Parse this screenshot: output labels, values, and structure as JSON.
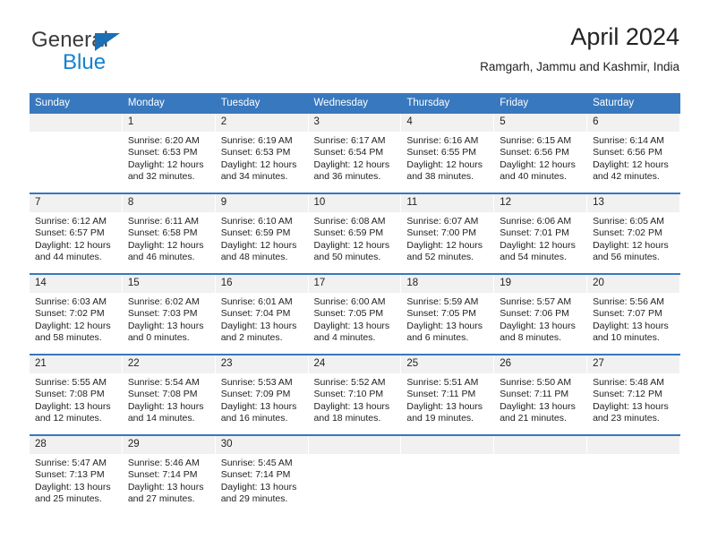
{
  "brand": {
    "name_top": "General",
    "name_bottom": "Blue",
    "triangle_color": "#1b6fb5",
    "blue_color": "#1581cf"
  },
  "header": {
    "title": "April 2024",
    "subtitle": "Ramgarh, Jammu and Kashmir, India"
  },
  "colors": {
    "header_row": "#3878be",
    "daynum_band": "#f1f1f1",
    "row_rule": "#3878be",
    "text": "#222222"
  },
  "weekday_headers": [
    "Sunday",
    "Monday",
    "Tuesday",
    "Wednesday",
    "Thursday",
    "Friday",
    "Saturday"
  ],
  "weeks": [
    [
      {
        "day": "",
        "sunrise": "",
        "sunset": "",
        "daylight": ""
      },
      {
        "day": "1",
        "sunrise": "Sunrise: 6:20 AM",
        "sunset": "Sunset: 6:53 PM",
        "daylight": "Daylight: 12 hours and 32 minutes."
      },
      {
        "day": "2",
        "sunrise": "Sunrise: 6:19 AM",
        "sunset": "Sunset: 6:53 PM",
        "daylight": "Daylight: 12 hours and 34 minutes."
      },
      {
        "day": "3",
        "sunrise": "Sunrise: 6:17 AM",
        "sunset": "Sunset: 6:54 PM",
        "daylight": "Daylight: 12 hours and 36 minutes."
      },
      {
        "day": "4",
        "sunrise": "Sunrise: 6:16 AM",
        "sunset": "Sunset: 6:55 PM",
        "daylight": "Daylight: 12 hours and 38 minutes."
      },
      {
        "day": "5",
        "sunrise": "Sunrise: 6:15 AM",
        "sunset": "Sunset: 6:56 PM",
        "daylight": "Daylight: 12 hours and 40 minutes."
      },
      {
        "day": "6",
        "sunrise": "Sunrise: 6:14 AM",
        "sunset": "Sunset: 6:56 PM",
        "daylight": "Daylight: 12 hours and 42 minutes."
      }
    ],
    [
      {
        "day": "7",
        "sunrise": "Sunrise: 6:12 AM",
        "sunset": "Sunset: 6:57 PM",
        "daylight": "Daylight: 12 hours and 44 minutes."
      },
      {
        "day": "8",
        "sunrise": "Sunrise: 6:11 AM",
        "sunset": "Sunset: 6:58 PM",
        "daylight": "Daylight: 12 hours and 46 minutes."
      },
      {
        "day": "9",
        "sunrise": "Sunrise: 6:10 AM",
        "sunset": "Sunset: 6:59 PM",
        "daylight": "Daylight: 12 hours and 48 minutes."
      },
      {
        "day": "10",
        "sunrise": "Sunrise: 6:08 AM",
        "sunset": "Sunset: 6:59 PM",
        "daylight": "Daylight: 12 hours and 50 minutes."
      },
      {
        "day": "11",
        "sunrise": "Sunrise: 6:07 AM",
        "sunset": "Sunset: 7:00 PM",
        "daylight": "Daylight: 12 hours and 52 minutes."
      },
      {
        "day": "12",
        "sunrise": "Sunrise: 6:06 AM",
        "sunset": "Sunset: 7:01 PM",
        "daylight": "Daylight: 12 hours and 54 minutes."
      },
      {
        "day": "13",
        "sunrise": "Sunrise: 6:05 AM",
        "sunset": "Sunset: 7:02 PM",
        "daylight": "Daylight: 12 hours and 56 minutes."
      }
    ],
    [
      {
        "day": "14",
        "sunrise": "Sunrise: 6:03 AM",
        "sunset": "Sunset: 7:02 PM",
        "daylight": "Daylight: 12 hours and 58 minutes."
      },
      {
        "day": "15",
        "sunrise": "Sunrise: 6:02 AM",
        "sunset": "Sunset: 7:03 PM",
        "daylight": "Daylight: 13 hours and 0 minutes."
      },
      {
        "day": "16",
        "sunrise": "Sunrise: 6:01 AM",
        "sunset": "Sunset: 7:04 PM",
        "daylight": "Daylight: 13 hours and 2 minutes."
      },
      {
        "day": "17",
        "sunrise": "Sunrise: 6:00 AM",
        "sunset": "Sunset: 7:05 PM",
        "daylight": "Daylight: 13 hours and 4 minutes."
      },
      {
        "day": "18",
        "sunrise": "Sunrise: 5:59 AM",
        "sunset": "Sunset: 7:05 PM",
        "daylight": "Daylight: 13 hours and 6 minutes."
      },
      {
        "day": "19",
        "sunrise": "Sunrise: 5:57 AM",
        "sunset": "Sunset: 7:06 PM",
        "daylight": "Daylight: 13 hours and 8 minutes."
      },
      {
        "day": "20",
        "sunrise": "Sunrise: 5:56 AM",
        "sunset": "Sunset: 7:07 PM",
        "daylight": "Daylight: 13 hours and 10 minutes."
      }
    ],
    [
      {
        "day": "21",
        "sunrise": "Sunrise: 5:55 AM",
        "sunset": "Sunset: 7:08 PM",
        "daylight": "Daylight: 13 hours and 12 minutes."
      },
      {
        "day": "22",
        "sunrise": "Sunrise: 5:54 AM",
        "sunset": "Sunset: 7:08 PM",
        "daylight": "Daylight: 13 hours and 14 minutes."
      },
      {
        "day": "23",
        "sunrise": "Sunrise: 5:53 AM",
        "sunset": "Sunset: 7:09 PM",
        "daylight": "Daylight: 13 hours and 16 minutes."
      },
      {
        "day": "24",
        "sunrise": "Sunrise: 5:52 AM",
        "sunset": "Sunset: 7:10 PM",
        "daylight": "Daylight: 13 hours and 18 minutes."
      },
      {
        "day": "25",
        "sunrise": "Sunrise: 5:51 AM",
        "sunset": "Sunset: 7:11 PM",
        "daylight": "Daylight: 13 hours and 19 minutes."
      },
      {
        "day": "26",
        "sunrise": "Sunrise: 5:50 AM",
        "sunset": "Sunset: 7:11 PM",
        "daylight": "Daylight: 13 hours and 21 minutes."
      },
      {
        "day": "27",
        "sunrise": "Sunrise: 5:48 AM",
        "sunset": "Sunset: 7:12 PM",
        "daylight": "Daylight: 13 hours and 23 minutes."
      }
    ],
    [
      {
        "day": "28",
        "sunrise": "Sunrise: 5:47 AM",
        "sunset": "Sunset: 7:13 PM",
        "daylight": "Daylight: 13 hours and 25 minutes."
      },
      {
        "day": "29",
        "sunrise": "Sunrise: 5:46 AM",
        "sunset": "Sunset: 7:14 PM",
        "daylight": "Daylight: 13 hours and 27 minutes."
      },
      {
        "day": "30",
        "sunrise": "Sunrise: 5:45 AM",
        "sunset": "Sunset: 7:14 PM",
        "daylight": "Daylight: 13 hours and 29 minutes."
      },
      {
        "day": "",
        "sunrise": "",
        "sunset": "",
        "daylight": ""
      },
      {
        "day": "",
        "sunrise": "",
        "sunset": "",
        "daylight": ""
      },
      {
        "day": "",
        "sunrise": "",
        "sunset": "",
        "daylight": ""
      },
      {
        "day": "",
        "sunrise": "",
        "sunset": "",
        "daylight": ""
      }
    ]
  ]
}
